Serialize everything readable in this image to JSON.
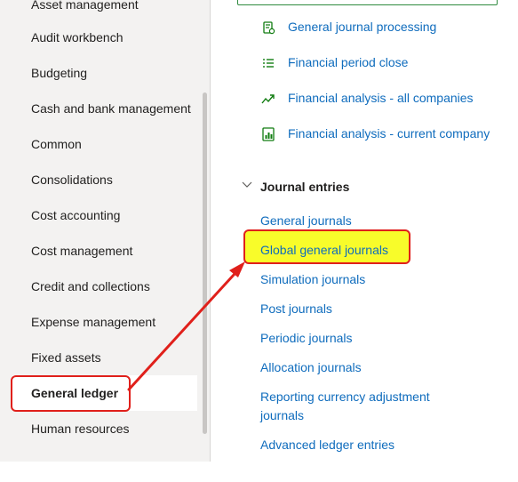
{
  "sidebar": {
    "modules": [
      "Asset management",
      "Audit workbench",
      "Budgeting",
      "Cash and bank management",
      "Common",
      "Consolidations",
      "Cost accounting",
      "Cost management",
      "Credit and collections",
      "Expense management",
      "Fixed assets",
      "General ledger",
      "Human resources"
    ],
    "selected": "General ledger"
  },
  "workspaces": [
    {
      "label": "General journal processing",
      "icon": "journal-processing-icon"
    },
    {
      "label": "Financial period close",
      "icon": "checklist-icon"
    },
    {
      "label": "Financial analysis - all companies",
      "icon": "trend-line-icon"
    },
    {
      "label": "Financial analysis - current company",
      "icon": "report-chart-icon"
    }
  ],
  "journal_entries": {
    "header": "Journal entries",
    "links": [
      "General journals",
      "Global general journals",
      "Simulation journals",
      "Post journals",
      "Periodic journals",
      "Allocation journals",
      "Reporting currency adjustment journals",
      "Advanced ledger entries"
    ],
    "highlighted": "Global general journals"
  },
  "colors": {
    "link": "#0f6cbd",
    "highlight_fill": "#f8fc2a",
    "annotation": "#e0201b",
    "sidebar_bg": "#f3f2f1"
  }
}
